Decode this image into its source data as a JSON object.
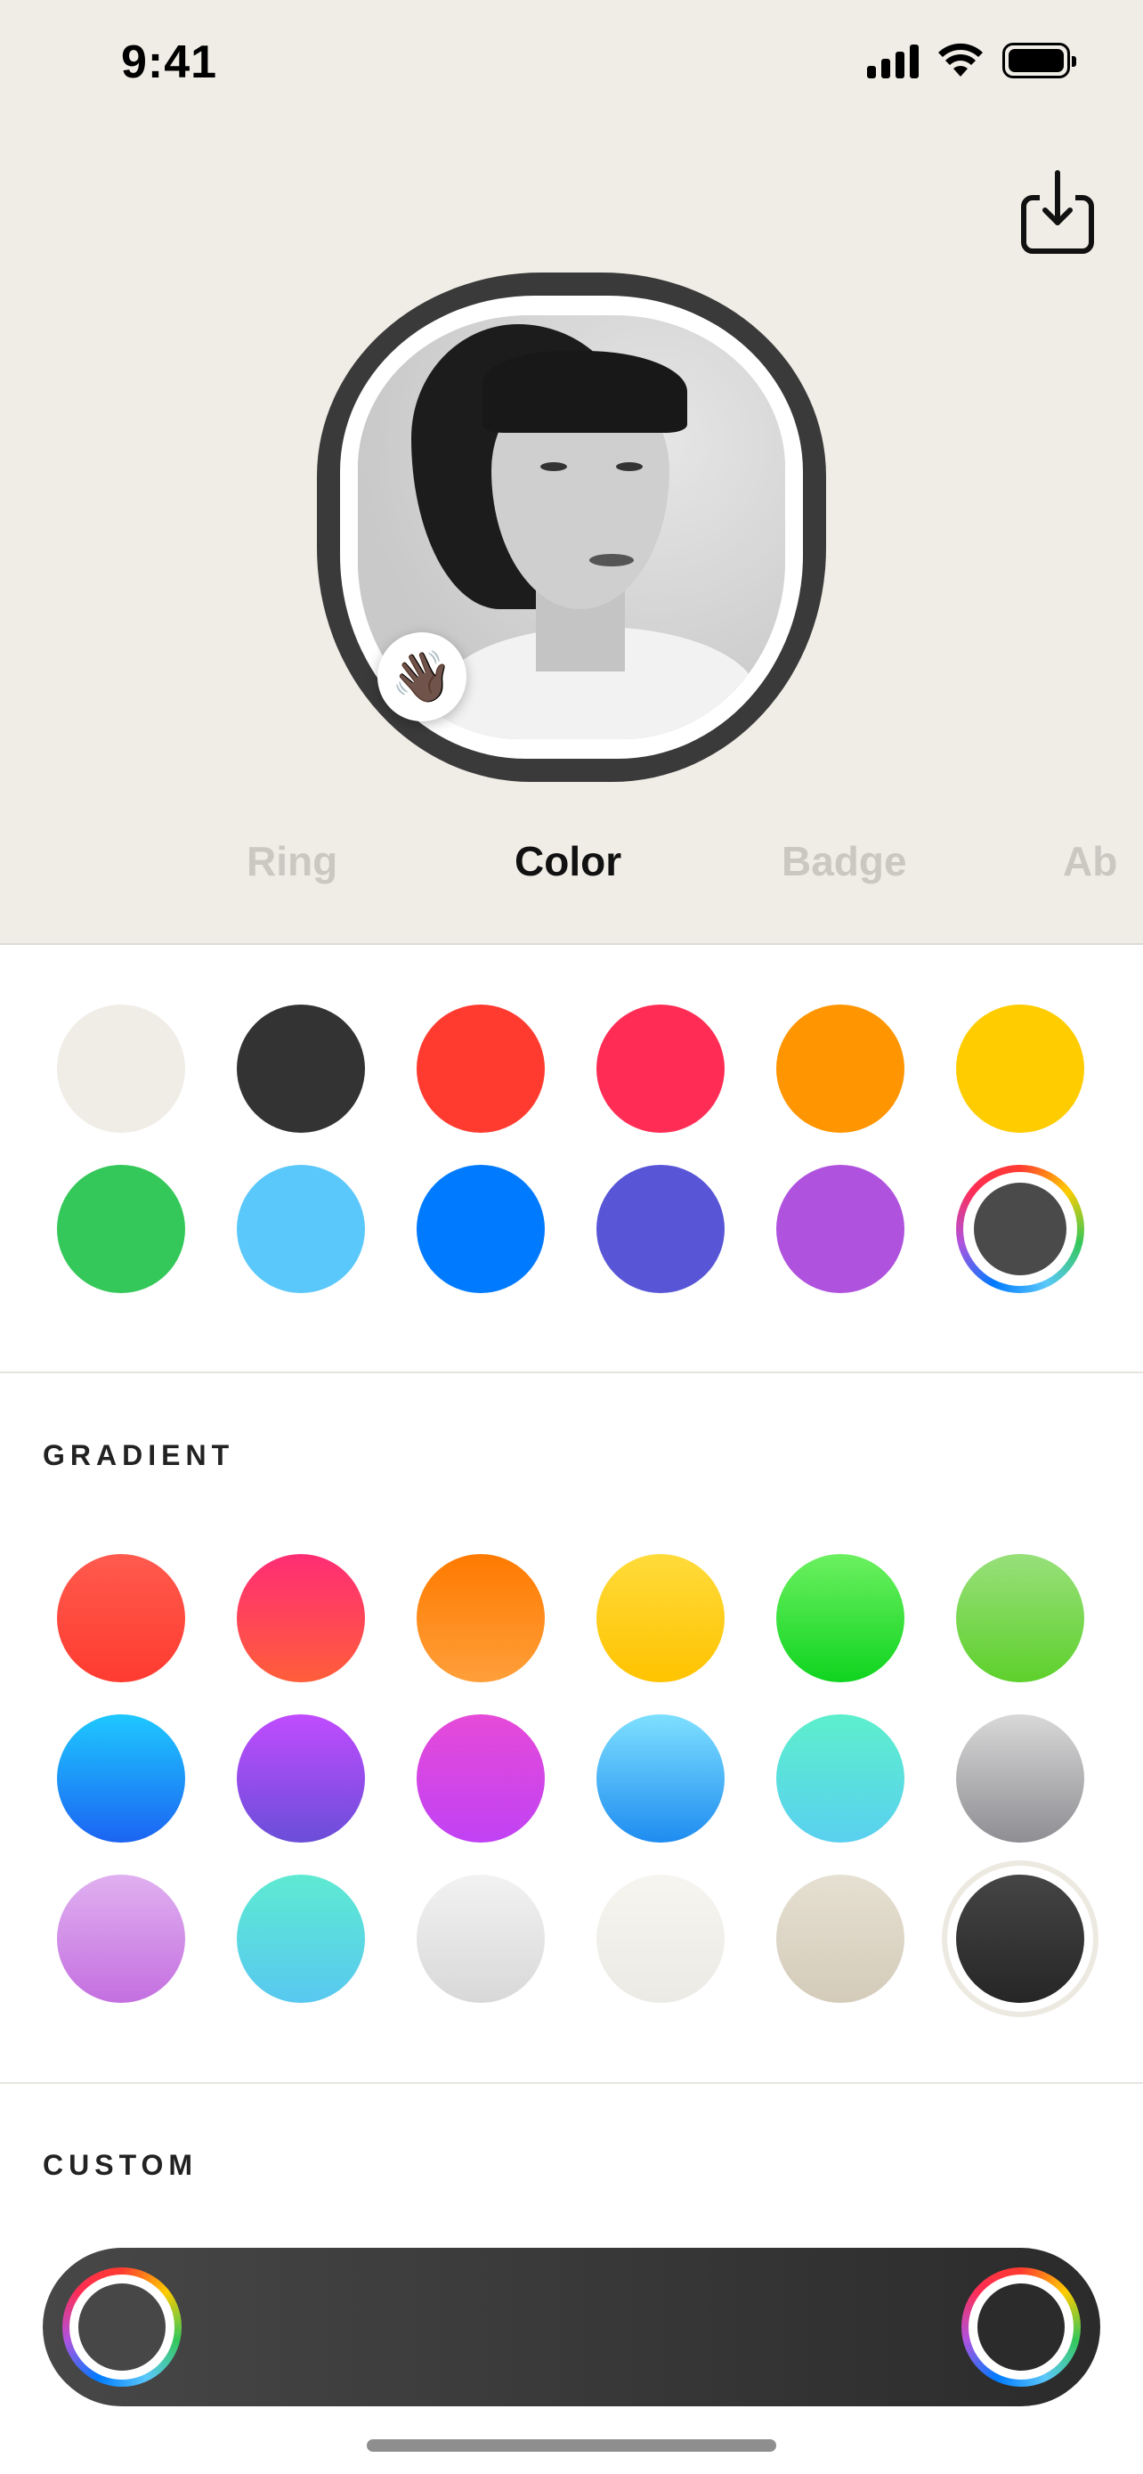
{
  "status_bar": {
    "time": "9:41"
  },
  "tabs": [
    {
      "label": "Ring",
      "active": false
    },
    {
      "label": "Color",
      "active": true
    },
    {
      "label": "Badge",
      "active": false
    },
    {
      "label": "Ab",
      "active": false
    }
  ],
  "avatar": {
    "badge_emoji": "👋🏿"
  },
  "solid_colors": [
    "#f0ede6",
    "#333333",
    "#ff3b30",
    "#ff2d55",
    "#ff9500",
    "#ffcc00",
    "#34c759",
    "#5ac8fa",
    "#007aff",
    "#5856d6",
    "#af52de"
  ],
  "solid_picker": {
    "inner_color": "#4a4a4a"
  },
  "gradient": {
    "label": "GRADIENT",
    "swatches": [
      [
        "#ff5a4e",
        "#ff3b30"
      ],
      [
        "#ff2d75",
        "#ff5e3a"
      ],
      [
        "#ff7a00",
        "#ff9f3a"
      ],
      [
        "#ffdb3a",
        "#ffc300"
      ],
      [
        "#6cf060",
        "#0fd41f"
      ],
      [
        "#98e07a",
        "#5ed02c"
      ],
      [
        "#1ec8ff",
        "#1c64f2"
      ],
      [
        "#c04cff",
        "#6a4ed8"
      ],
      [
        "#e64ad8",
        "#c042f4"
      ],
      [
        "#7ee0ff",
        "#1e8cf0"
      ],
      [
        "#5cefcc",
        "#5ad0f0"
      ],
      [
        "#d8d8d8",
        "#8e8e93"
      ],
      [
        "#e0b0f0",
        "#c46fe0"
      ],
      [
        "#5eead2",
        "#58c8f0"
      ],
      [
        "#f2f2f2",
        "#d8d8d8"
      ],
      [
        "#f6f5f0",
        "#eceae4"
      ],
      [
        "#e6e0d2",
        "#d4cbb9"
      ],
      [
        "#454545",
        "#262626"
      ]
    ],
    "selected_index": 17
  },
  "custom": {
    "label": "CUSTOM",
    "start_color": "#474747",
    "end_color": "#2b2b2b"
  }
}
